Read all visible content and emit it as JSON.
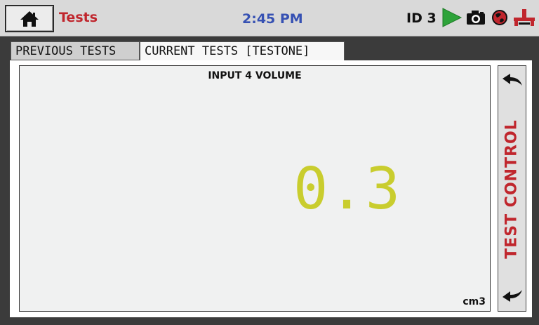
{
  "topbar": {
    "home_icon": "home-icon",
    "title": "Tests",
    "time": "2:45 PM",
    "id_label": "ID 3",
    "status_icons": [
      "play-icon",
      "camera-icon",
      "globe-icon",
      "network-icon"
    ],
    "colors": {
      "title": "#c0262d",
      "time": "#3651b3",
      "play": "#2ea33a"
    }
  },
  "tabs": [
    {
      "label": "PREVIOUS TESTS",
      "active": false
    },
    {
      "label": "CURRENT TESTS [TESTONE]",
      "active": true
    }
  ],
  "display": {
    "title": "INPUT 4 VOLUME",
    "value": "0.3",
    "unit": "cm3",
    "value_color": "#c9cd2e"
  },
  "side_control": {
    "label": "TEST CONTROL",
    "up_icon": "back-arrow-icon",
    "down_icon": "back-arrow-down-icon"
  }
}
